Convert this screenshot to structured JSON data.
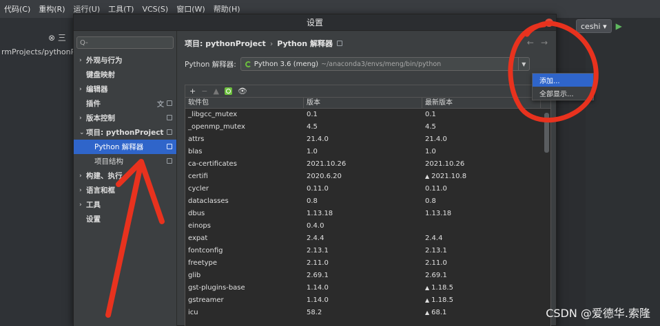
{
  "ide": {
    "menu": [
      "代码(C)",
      "重构(R)",
      "运行(U)",
      "工具(T)",
      "VCS(S)",
      "窗口(W)",
      "帮助(H)"
    ],
    "project_path": "rmProjects/pythonProj",
    "run_config": "ceshi",
    "left_icons": "⊗ 三"
  },
  "dialog": {
    "title": "设置",
    "search_placeholder": "Q-"
  },
  "sidebar": {
    "items": [
      {
        "label": "外观与行为",
        "arrow": "›"
      },
      {
        "label": "键盘映射",
        "arrow": ""
      },
      {
        "label": "编辑器",
        "arrow": "›"
      },
      {
        "label": "插件",
        "arrow": ""
      },
      {
        "label": "版本控制",
        "arrow": "›"
      },
      {
        "label": "项目: pythonProject",
        "arrow": "⌄"
      },
      {
        "label": "Python 解释器",
        "arrow": ""
      },
      {
        "label": "项目结构",
        "arrow": ""
      },
      {
        "label": "构建、执行、",
        "arrow": "›"
      },
      {
        "label": "语言和框",
        "arrow": "›"
      },
      {
        "label": "工具",
        "arrow": "›"
      },
      {
        "label": "设置",
        "arrow": ""
      }
    ]
  },
  "breadcrumb": {
    "project": "项目: pythonProject",
    "sep": "›",
    "page": "Python 解释器"
  },
  "interpreter": {
    "label": "Python 解释器:",
    "name": "Python 3.6 (meng)",
    "path": "~/anaconda3/envs/meng/bin/python"
  },
  "popup": {
    "add": "添加...",
    "show_all": "全部显示..."
  },
  "table": {
    "toolbar": {
      "add": "+",
      "remove": "−",
      "up": "▲"
    },
    "headers": [
      "软件包",
      "版本",
      "最新版本"
    ],
    "rows": [
      {
        "pkg": "_libgcc_mutex",
        "ver": "0.1",
        "latest": "0.1",
        "upgrade": false
      },
      {
        "pkg": "_openmp_mutex",
        "ver": "4.5",
        "latest": "4.5",
        "upgrade": false
      },
      {
        "pkg": "attrs",
        "ver": "21.4.0",
        "latest": "21.4.0",
        "upgrade": false
      },
      {
        "pkg": "blas",
        "ver": "1.0",
        "latest": "1.0",
        "upgrade": false
      },
      {
        "pkg": "ca-certificates",
        "ver": "2021.10.26",
        "latest": "2021.10.26",
        "upgrade": false
      },
      {
        "pkg": "certifi",
        "ver": "2020.6.20",
        "latest": "2021.10.8",
        "upgrade": true
      },
      {
        "pkg": "cycler",
        "ver": "0.11.0",
        "latest": "0.11.0",
        "upgrade": false
      },
      {
        "pkg": "dataclasses",
        "ver": "0.8",
        "latest": "0.8",
        "upgrade": false
      },
      {
        "pkg": "dbus",
        "ver": "1.13.18",
        "latest": "1.13.18",
        "upgrade": false
      },
      {
        "pkg": "einops",
        "ver": "0.4.0",
        "latest": "",
        "upgrade": false
      },
      {
        "pkg": "expat",
        "ver": "2.4.4",
        "latest": "2.4.4",
        "upgrade": false
      },
      {
        "pkg": "fontconfig",
        "ver": "2.13.1",
        "latest": "2.13.1",
        "upgrade": false
      },
      {
        "pkg": "freetype",
        "ver": "2.11.0",
        "latest": "2.11.0",
        "upgrade": false
      },
      {
        "pkg": "glib",
        "ver": "2.69.1",
        "latest": "2.69.1",
        "upgrade": false
      },
      {
        "pkg": "gst-plugins-base",
        "ver": "1.14.0",
        "latest": "1.18.5",
        "upgrade": true
      },
      {
        "pkg": "gstreamer",
        "ver": "1.14.0",
        "latest": "1.18.5",
        "upgrade": true
      },
      {
        "pkg": "icu",
        "ver": "58.2",
        "latest": "68.1",
        "upgrade": true
      }
    ]
  },
  "watermark": "CSDN @爱德华.索隆",
  "colors": {
    "selection": "#2f65ca",
    "annotation": "#e8321e"
  }
}
